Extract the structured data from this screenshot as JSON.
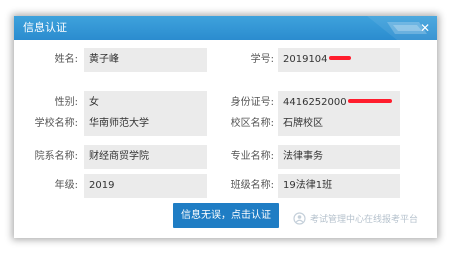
{
  "dialog": {
    "title": "信息认证",
    "close_label": "✕"
  },
  "fields": {
    "name": {
      "label": "姓名:",
      "value": "黄子峰"
    },
    "student_id": {
      "label": "学号:",
      "value": "2019104"
    },
    "gender": {
      "label": "性别:",
      "value": "女"
    },
    "id_number": {
      "label": "身份证号:",
      "value": "4416252000"
    },
    "school": {
      "label": "学校名称:",
      "value": "华南师范大学"
    },
    "campus": {
      "label": "校区名称:",
      "value": "石牌校区"
    },
    "department": {
      "label": "院系名称:",
      "value": "财经商贸学院"
    },
    "major": {
      "label": "专业名称:",
      "value": "法律事务"
    },
    "grade": {
      "label": "年级:",
      "value": "2019"
    },
    "class": {
      "label": "班级名称:",
      "value": "19法律1班"
    }
  },
  "confirm_button": "信息无误，点击认证",
  "watermark_text": "考试管理中心在线报考平台",
  "colors": {
    "titlebar": "#2b8ccf",
    "button": "#1f7dc4",
    "field_bg": "#ebebeb",
    "redaction": "#ff1d2d"
  }
}
